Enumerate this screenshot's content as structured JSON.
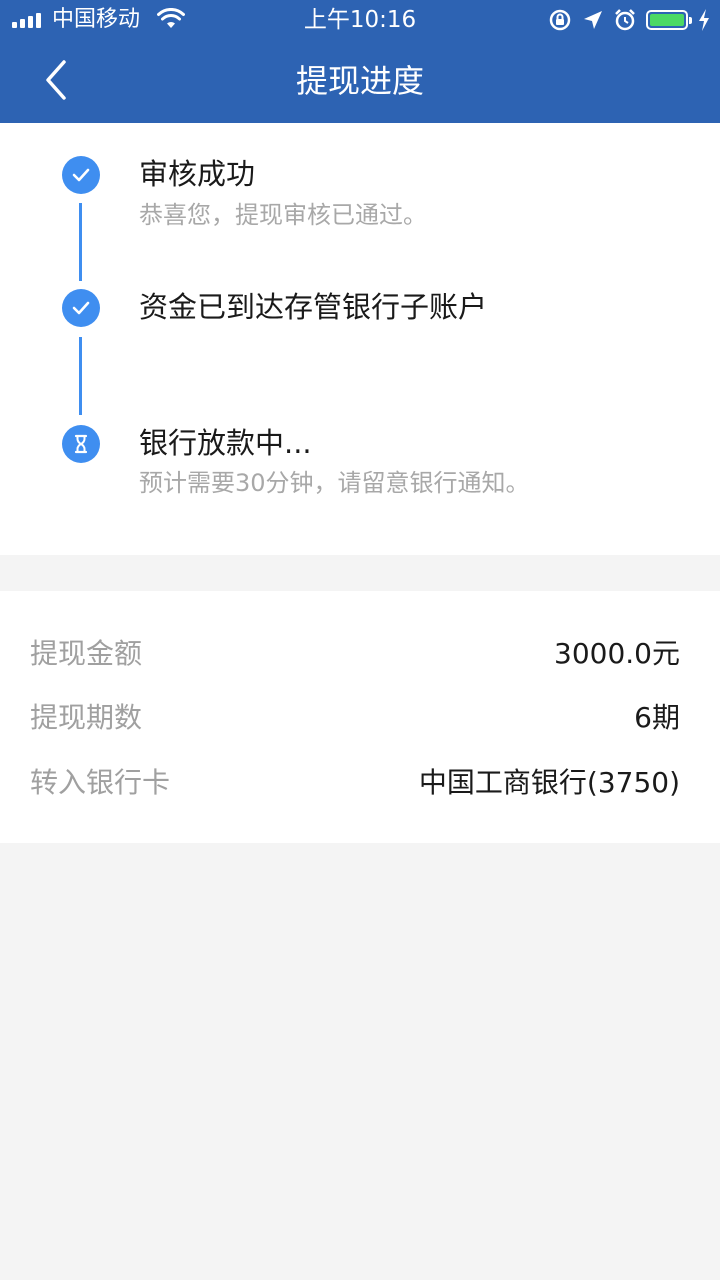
{
  "status_bar": {
    "carrier": "中国移动",
    "time": "上午10:16",
    "battery_color": "#4cd964"
  },
  "nav": {
    "title": "提现进度",
    "back_icon": "chevron-left-icon"
  },
  "steps": [
    {
      "title": "审核成功",
      "desc": "恭喜您，提现审核已通过。",
      "icon": "check-icon",
      "status": "done"
    },
    {
      "title": "资金已到达存管银行子账户",
      "desc": "",
      "icon": "check-icon",
      "status": "done"
    },
    {
      "title": "银行放款中...",
      "desc": "预计需要30分钟，请留意银行通知。",
      "icon": "hourglass-icon",
      "status": "in-progress"
    }
  ],
  "details": [
    {
      "label": "提现金额",
      "value": "3000.0元"
    },
    {
      "label": "提现期数",
      "value": "6期"
    },
    {
      "label": "转入银行卡",
      "value": "中国工商银行(3750)"
    }
  ],
  "colors": {
    "header": "#2d63b3",
    "accent": "#3f8ef0",
    "background": "#f4f4f4"
  }
}
